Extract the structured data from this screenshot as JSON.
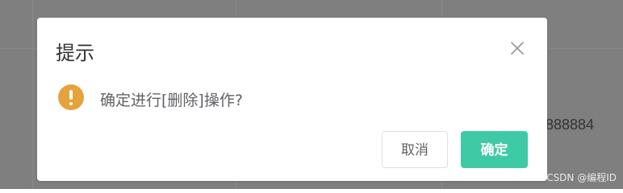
{
  "background": {
    "cell_value": "888884",
    "watermark": "CSDN @编程ID"
  },
  "dialog": {
    "title": "提示",
    "close_icon": "close-icon",
    "status_icon": "warning-icon",
    "message": "确定进行[删除]操作?",
    "cancel_label": "取消",
    "confirm_label": "确定"
  },
  "colors": {
    "overlay": "#7f7f7f",
    "warning": "#e6a23c",
    "primary": "#3ecaa5",
    "text_primary": "#303133",
    "text_regular": "#606266"
  }
}
